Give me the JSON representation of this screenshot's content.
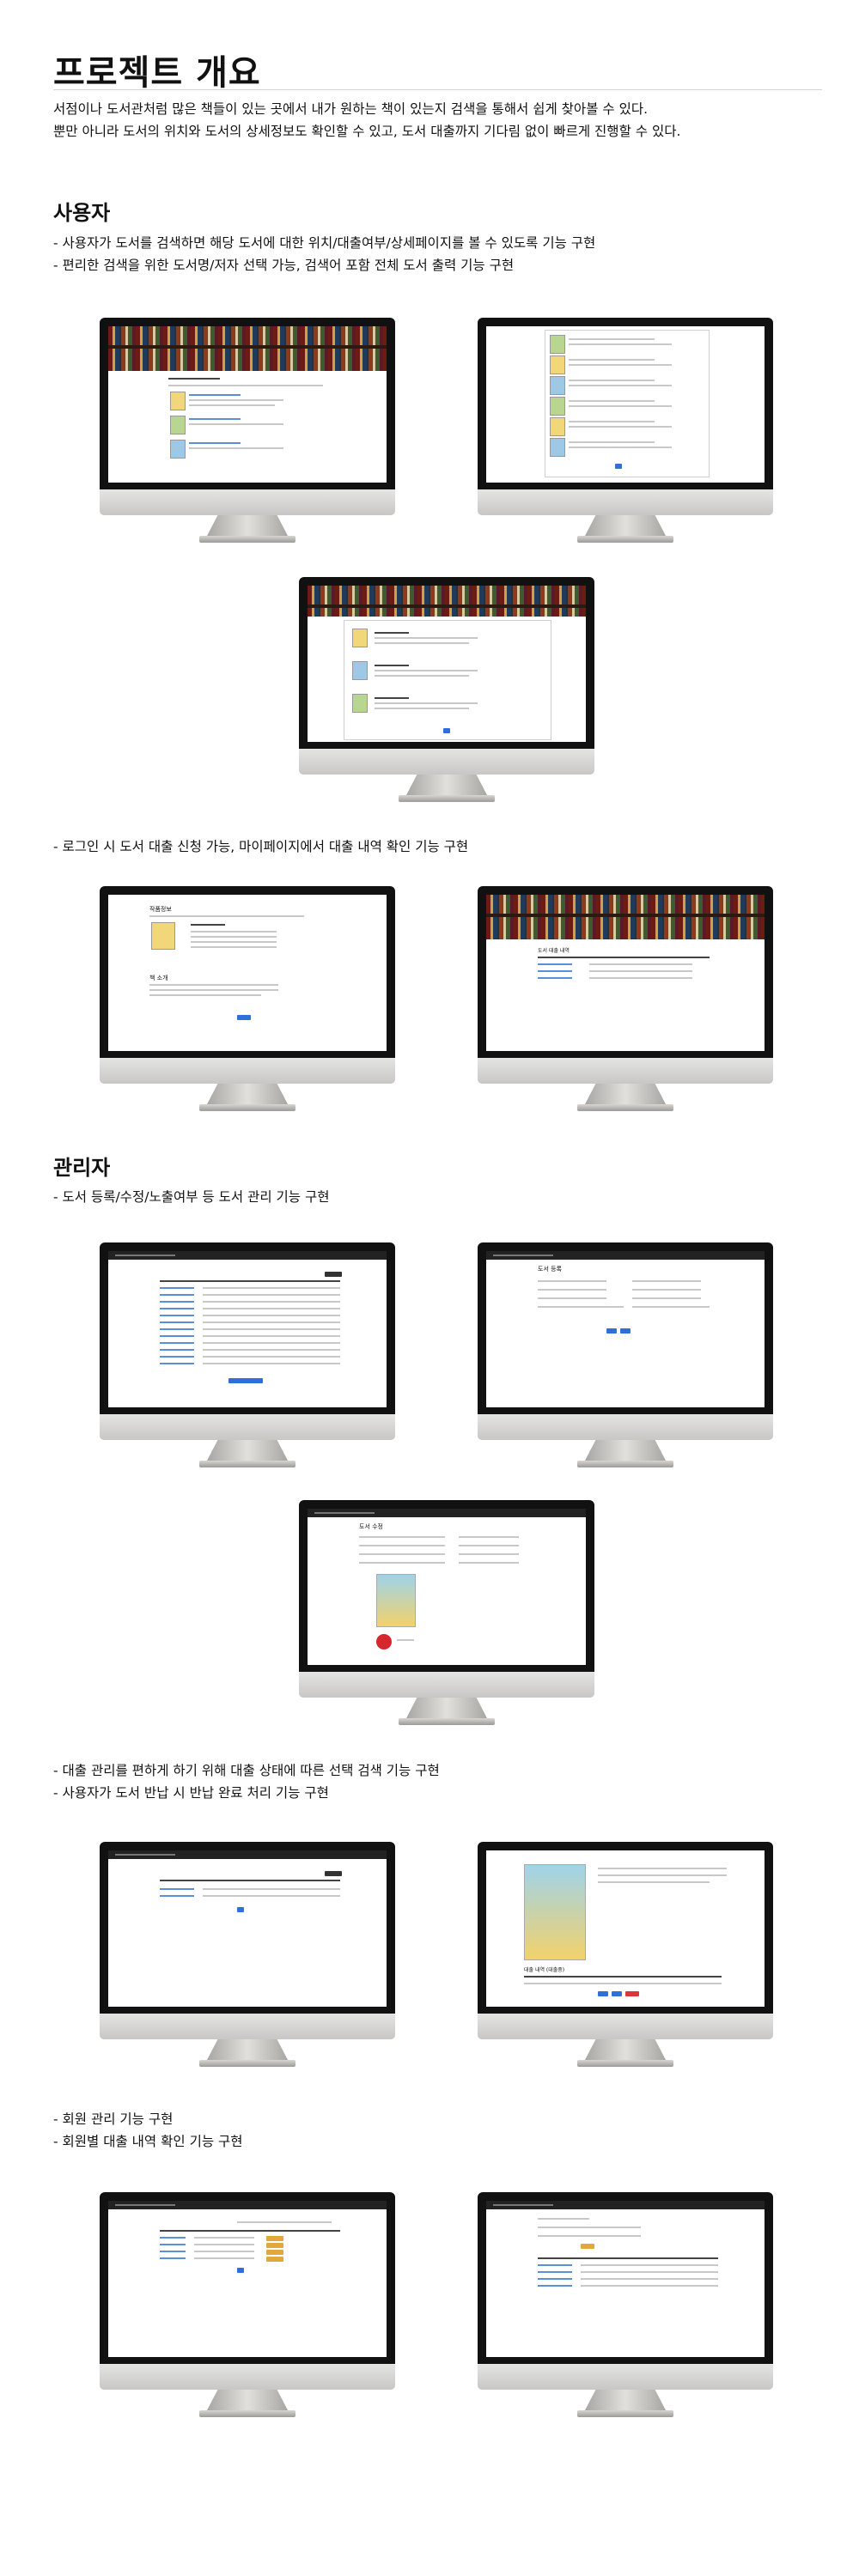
{
  "overview": {
    "title": "프로젝트 개요",
    "lines": [
      "서점이나 도서관처럼 많은 책들이 있는 곳에서 내가 원하는 책이 있는지 검색을 통해서 쉽게 찾아볼 수 있다.",
      "뿐만 아니라 도서의 위치와 도서의 상세정보도 확인할 수 있고, 도서 대출까지 기다림 없이 빠르게 진행할 수 있다."
    ]
  },
  "user_section": {
    "heading": "사용자",
    "bullets_search": [
      "- 사용자가 도서를 검색하면 해당 도서에 대한 위치/대출여부/상세페이지를 볼 수 있도록 기능 구현",
      "- 편리한 검색을 위한 도서명/저자 선택 가능, 검색어 포함 전체 도서 출력 기능 구현"
    ],
    "bullets_loan": [
      "- 로그인 시 도서 대출 신청 가능, 마이페이지에서 대출 내역 확인 기능 구현"
    ],
    "screens": {
      "detail_heading": "작품정보",
      "review_heading": "책 소개",
      "loan_history_heading": "도서 대출 내역"
    }
  },
  "admin_section": {
    "heading": "관리자",
    "bullets_manage": [
      "- 도서 등록/수정/노출여부 등 도서 관리 기능 구현"
    ],
    "bullets_loan": [
      "- 대출 관리를 편하게 하기 위해 대출 상태에 따른 선택 검색 기능 구현",
      "- 사용자가 도서 반납 시 반납 완료 처리 기능 구현"
    ],
    "bullets_member": [
      "- 회원 관리 기능 구현",
      "- 회원별 대출 내역 확인 기능 구현"
    ],
    "screens": {
      "register_heading": "도서 등록",
      "edit_heading": "도서 수정",
      "return_heading": "대출 내역 (대출중)"
    }
  },
  "colors": {
    "accent_blue": "#2f6fdc",
    "danger_red": "#d9363e",
    "nav_dark": "#222222"
  },
  "icons": [
    "imac-monitor"
  ]
}
